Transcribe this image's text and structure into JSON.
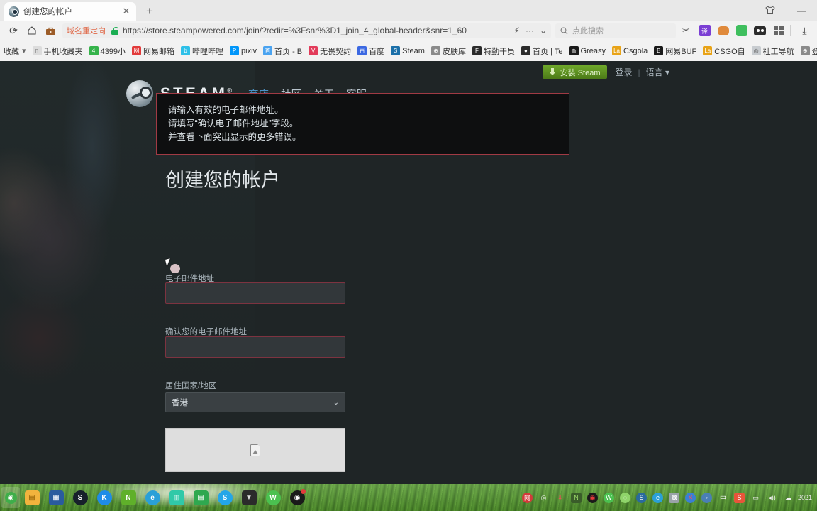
{
  "browser": {
    "tab": {
      "title": "创建您的帐户",
      "favicon": "steam-icon",
      "close": "✕"
    },
    "new_tab_label": "+",
    "window_controls": [
      {
        "name": "skin-icon",
        "glyph": "♕"
      },
      {
        "name": "minimize-button",
        "glyph": "—"
      }
    ],
    "nav_buttons": [
      {
        "name": "reload-button",
        "glyph": "⟳"
      },
      {
        "name": "home-button",
        "glyph": "⌂"
      },
      {
        "name": "toolbox-button",
        "glyph": "▣"
      }
    ],
    "omnibox": {
      "redirect_tag": "域名重定向",
      "url": "https://store.steampowered.com/join/?redir=%3Fsnr%3D1_join_4_global-header&snr=1_60",
      "lightning_glyph": "⚡",
      "more_glyph": "···",
      "chevron_glyph": "⌄"
    },
    "search": {
      "placeholder": "点此搜索",
      "icon": "search-icon"
    },
    "toolbar_icons": [
      {
        "name": "scissors-icon",
        "glyph": "✂",
        "color": "#555555",
        "bg": "transparent"
      },
      {
        "name": "translate-icon",
        "glyph": "译",
        "color": "#ffffff",
        "bg": "#7b3fd4"
      },
      {
        "name": "gamepad-icon",
        "glyph": "🎮",
        "color": "#ffffff",
        "bg": "#e08a3c"
      },
      {
        "name": "note-icon",
        "glyph": "▢",
        "color": "#ffffff",
        "bg": "#3fbf5e"
      },
      {
        "name": "panda-icon",
        "glyph": "●●",
        "color": "#ffffff",
        "bg": "#2c2c2c"
      },
      {
        "name": "apps-grid-icon",
        "glyph": "▦",
        "color": "#555555",
        "bg": "transparent"
      },
      {
        "name": "download-icon",
        "glyph": "⤓",
        "color": "#444444",
        "bg": "transparent"
      }
    ],
    "bookmarks": {
      "folder_label": "收藏",
      "folder_caret": "▾",
      "items": [
        {
          "label": "手机收藏夹",
          "icon": "phone-folder-icon",
          "glyph": "▯",
          "bg": "#dcdcdc",
          "fg": "#555555"
        },
        {
          "label": "4399小",
          "icon": "4399-icon",
          "glyph": "4",
          "bg": "#35b34a",
          "fg": "#ffffff"
        },
        {
          "label": "网易邮箱",
          "icon": "netease-mail-icon",
          "glyph": "网",
          "bg": "#e23b3b",
          "fg": "#ffffff"
        },
        {
          "label": "哔哩哔哩",
          "icon": "bilibili-icon",
          "glyph": "b",
          "bg": "#2ec0e8",
          "fg": "#ffffff"
        },
        {
          "label": "pixiv",
          "icon": "pixiv-icon",
          "glyph": "P",
          "bg": "#0096fa",
          "fg": "#ffffff"
        },
        {
          "label": "首页 - B",
          "icon": "home-b-icon",
          "glyph": "首",
          "bg": "#4aa3f0",
          "fg": "#ffffff"
        },
        {
          "label": "无畏契约",
          "icon": "valorant-icon",
          "glyph": "V",
          "bg": "#e23b5a",
          "fg": "#ffffff"
        },
        {
          "label": "百度",
          "icon": "baidu-icon",
          "glyph": "百",
          "bg": "#3b68e2",
          "fg": "#ffffff"
        },
        {
          "label": "Steam",
          "icon": "steam-icon",
          "glyph": "S",
          "bg": "#1b6fa8",
          "fg": "#ffffff"
        },
        {
          "label": "皮肤库",
          "icon": "globe-icon",
          "glyph": "⊕",
          "bg": "#8a8a8a",
          "fg": "#ffffff"
        },
        {
          "label": "特勤干员",
          "icon": "agent-icon",
          "glyph": "F",
          "bg": "#2b2b2b",
          "fg": "#ffffff"
        },
        {
          "label": "首页 | Te",
          "icon": "panda-icon",
          "glyph": "●",
          "bg": "#2b2b2b",
          "fg": "#ffffff"
        },
        {
          "label": "Greasy",
          "icon": "greasyfork-icon",
          "glyph": "◍",
          "bg": "#1a1a1a",
          "fg": "#ffffff"
        },
        {
          "label": "Csgola",
          "icon": "csgola-icon",
          "glyph": "La",
          "bg": "#e8a317",
          "fg": "#ffffff"
        },
        {
          "label": "网易BUF",
          "icon": "netease-buff-icon",
          "glyph": "B",
          "bg": "#1a1a1a",
          "fg": "#ffffff"
        },
        {
          "label": "CSGO自",
          "icon": "csgo-icon",
          "glyph": "La",
          "bg": "#e8a317",
          "fg": "#ffffff"
        },
        {
          "label": "社工导航",
          "icon": "social-nav-icon",
          "glyph": "◎",
          "bg": "#c8ccd0",
          "fg": "#555555"
        },
        {
          "label": "登",
          "icon": "globe-icon",
          "glyph": "⊕",
          "bg": "#8a8a8a",
          "fg": "#ffffff"
        }
      ]
    }
  },
  "steam": {
    "logo_text": "STEAM",
    "logo_reg": "®",
    "nav": [
      {
        "label": "商店",
        "active": true
      },
      {
        "label": "社区",
        "active": false
      },
      {
        "label": "关于",
        "active": false
      },
      {
        "label": "客服",
        "active": false
      }
    ],
    "install_button": "安装 Steam",
    "login_link": "登录",
    "divider": "|",
    "language_menu": "语言 ▾",
    "accent_green": "#6fa82a",
    "accent_blue": "#4c91c6",
    "page_bg": "#1f2526"
  },
  "form": {
    "errors": [
      "请输入有效的电子邮件地址。",
      "请填写“确认电子邮件地址”字段。",
      "并查看下面突出显示的更多错误。"
    ],
    "error_border_color": "#a13a44",
    "heading": "创建您的帐户",
    "email_label": "电子邮件地址",
    "email_value": "",
    "email_confirm_label": "确认您的电子邮件地址",
    "email_confirm_value": "",
    "country_label": "居住国家/地区",
    "country_value": "香港",
    "country_caret": "⌄",
    "captcha_alt_icon": "broken-image-icon"
  },
  "taskbar": {
    "start": {
      "name": "start-button",
      "glyph": "◉",
      "bg": "rgba(255,255,255,0.25)",
      "fg": "#2c7a2c"
    },
    "pinned": [
      {
        "name": "file-explorer-icon",
        "glyph": "▤",
        "bg": "#f2b33d",
        "fg": "#8a5a00",
        "shape": "sq"
      },
      {
        "name": "microsoft-store-icon",
        "glyph": "▦",
        "bg": "#2a5b9e",
        "fg": "#ffffff",
        "shape": "sq"
      },
      {
        "name": "steam-icon",
        "glyph": "S",
        "bg": "#17202b",
        "fg": "#ffffff",
        "shape": "circ"
      },
      {
        "name": "kugou-icon",
        "glyph": "K",
        "bg": "#1f8ce8",
        "fg": "#ffffff",
        "shape": "circ"
      },
      {
        "name": "nvidia-icon",
        "glyph": "N",
        "bg": "#5fb02a",
        "fg": "#ffffff",
        "shape": "sq"
      },
      {
        "name": "ie-icon",
        "glyph": "e",
        "bg": "#2aa0d8",
        "fg": "#ffffff",
        "shape": "circ"
      },
      {
        "name": "office-icon",
        "glyph": "▥",
        "bg": "#30c9a8",
        "fg": "#ffffff",
        "shape": "sq"
      },
      {
        "name": "excel-icon",
        "glyph": "▤",
        "bg": "#2fa84f",
        "fg": "#ffffff",
        "shape": "sq"
      },
      {
        "name": "skype-icon",
        "glyph": "S",
        "bg": "#23a6e8",
        "fg": "#ffffff",
        "shape": "circ"
      },
      {
        "name": "faceit-icon",
        "glyph": "▼",
        "bg": "#2b2b2b",
        "fg": "#dddddd",
        "shape": "sq"
      },
      {
        "name": "wechat-icon",
        "glyph": "W",
        "bg": "#4bc150",
        "fg": "#ffffff",
        "shape": "circ"
      },
      {
        "name": "obs-icon",
        "glyph": "◉",
        "bg": "#1a1a1a",
        "fg": "#ffffff",
        "shape": "circ",
        "badge": true
      }
    ],
    "tray": [
      {
        "name": "app-red-icon",
        "glyph": "网",
        "bg": "#d33a3a",
        "fg": "#ffffff",
        "shape": "circ"
      },
      {
        "name": "settings-icon",
        "glyph": "◎",
        "bg": "transparent",
        "fg": "#f0f0f0",
        "shape": "circ"
      },
      {
        "name": "download-arrow-icon",
        "glyph": "⬇",
        "bg": "transparent",
        "fg": "#e05555",
        "shape": "circ"
      },
      {
        "name": "nvidia-tray-icon",
        "glyph": "N",
        "bg": "#3a5c2a",
        "fg": "#9ad66a",
        "shape": "sq"
      },
      {
        "name": "obs-tray-icon",
        "glyph": "◉",
        "bg": "#1a1a1a",
        "fg": "#e23b3b",
        "shape": "circ"
      },
      {
        "name": "wechat-tray-icon",
        "glyph": "W",
        "bg": "#4bc150",
        "fg": "#ffffff",
        "shape": "circ"
      },
      {
        "name": "qq-green-icon",
        "glyph": "◌",
        "bg": "#8fd46a",
        "fg": "#ffffff",
        "shape": "circ"
      },
      {
        "name": "steam-tray-icon",
        "glyph": "S",
        "bg": "#2a6a9e",
        "fg": "#ffffff",
        "shape": "circ"
      },
      {
        "name": "edge-tray-icon",
        "glyph": "e",
        "bg": "#2aa0d8",
        "fg": "#ffffff",
        "shape": "circ"
      },
      {
        "name": "app-gray-icon",
        "glyph": "▩",
        "bg": "#9aa3a8",
        "fg": "#ffffff",
        "shape": "sq"
      },
      {
        "name": "close-x-icon",
        "glyph": "✕",
        "bg": "#3b7fd4",
        "fg": "#ff5050",
        "shape": "circ"
      },
      {
        "name": "pin-icon",
        "glyph": "◦",
        "bg": "#4a7fb5",
        "fg": "#ffffff",
        "shape": "circ"
      },
      {
        "name": "ime-icon",
        "glyph": "中",
        "bg": "transparent",
        "fg": "#ffffff",
        "shape": "sq"
      },
      {
        "name": "sogou-icon",
        "glyph": "S",
        "bg": "#e8543a",
        "fg": "#ffffff",
        "shape": "sq"
      },
      {
        "name": "display-icon",
        "glyph": "▭",
        "bg": "transparent",
        "fg": "#f0f0f0",
        "shape": "sq"
      },
      {
        "name": "volume-icon",
        "glyph": "◂))",
        "bg": "transparent",
        "fg": "#f0f0f0",
        "shape": "sq"
      },
      {
        "name": "cloud-icon",
        "glyph": "☁",
        "bg": "transparent",
        "fg": "#f0f0f0",
        "shape": "sq"
      }
    ],
    "clock": "2021"
  }
}
